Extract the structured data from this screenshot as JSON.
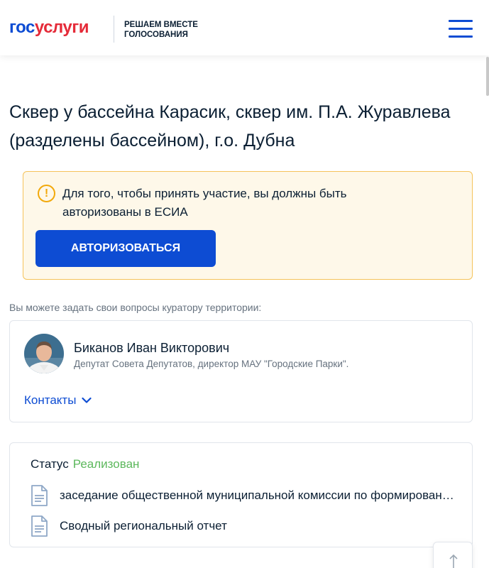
{
  "header": {
    "logo_part1": "гос",
    "logo_part2": "услуги",
    "tagline_line1": "РЕШАЕМ ВМЕСТЕ",
    "tagline_line2": "ГОЛОСОВАНИЯ",
    "menu_icon": "hamburger-icon"
  },
  "page": {
    "title": "Сквер у бассейна Карасик, сквер им. П.А. Журавлева (разделены бассейном), г.о. Дубна"
  },
  "warning": {
    "icon": "exclamation-circle-icon",
    "text": "Для того, чтобы принять участие, вы должны быть авторизованы в ЕСИА",
    "button_label": "Авторизоваться"
  },
  "curator": {
    "ask_label": "Вы можете задать свои вопросы куратору территории:",
    "name": "Биканов Иван Викторович",
    "role": "Депутат Совета Депутатов, директор МАУ \"Городские Парки\".",
    "contacts_label": "Контакты"
  },
  "status": {
    "label": "Статус",
    "value": "Реализован",
    "documents": [
      {
        "title": "заседание общественной муниципальной комиссии по формированию",
        "icon": "document-icon"
      },
      {
        "title": "Сводный региональный отчет",
        "icon": "document-icon"
      }
    ]
  },
  "scroll_top_icon": "arrow-up-icon",
  "colors": {
    "brand_blue": "#0d4cd3",
    "brand_red": "#e52b39",
    "warning_bg": "#fef8e9",
    "warning_border": "#f5c35a",
    "status_green": "#5cb85c"
  }
}
